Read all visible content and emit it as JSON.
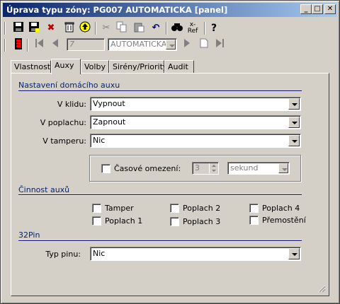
{
  "window": {
    "title": "Úprava typu zóny: PG007 AUTOMATICKA [panel]",
    "min_label": "_",
    "max_label": "□",
    "close_label": "✕"
  },
  "toolbar1": {
    "icons": [
      "save-icon",
      "save-as-icon",
      "delete-icon",
      "trash-icon",
      "up-icon",
      "cut-icon",
      "copy-icon",
      "paste-icon",
      "undo-icon",
      "find-icon",
      "xref-icon",
      "help-icon"
    ],
    "xref_label": "x-\nRef",
    "help_label": "?"
  },
  "toolbar2": {
    "record_number": "7",
    "record_name": "AUTOMATICKA"
  },
  "tabs": [
    {
      "label": "Vlastnosti"
    },
    {
      "label": "Auxy"
    },
    {
      "label": "Volby"
    },
    {
      "label": "Sirény/Priority"
    },
    {
      "label": "Audit"
    }
  ],
  "active_tab": "Auxy",
  "section_aux": {
    "title": "Nastavení domácího auxu",
    "rows": [
      {
        "label": "V klidu:",
        "value": "Vypnout"
      },
      {
        "label": "V poplachu:",
        "value": "Zapnout"
      },
      {
        "label": "V tamperu:",
        "value": "Nic"
      }
    ],
    "time_limit": {
      "label": "Časové omezení:",
      "checked": false,
      "number": "3",
      "unit": "sekund"
    }
  },
  "section_activity": {
    "title": "Činnost auxů",
    "checkboxes": [
      {
        "label": "Tamper",
        "checked": false
      },
      {
        "label": "Poplach 1",
        "checked": false
      },
      {
        "label": "Poplach 2",
        "checked": false
      },
      {
        "label": "Poplach 3",
        "checked": false
      },
      {
        "label": "Poplach 4",
        "checked": false
      },
      {
        "label": "Přemostění",
        "checked": false
      }
    ]
  },
  "section_pin": {
    "title": "32Pin",
    "label": "Typ pinu:",
    "value": "Nic"
  }
}
